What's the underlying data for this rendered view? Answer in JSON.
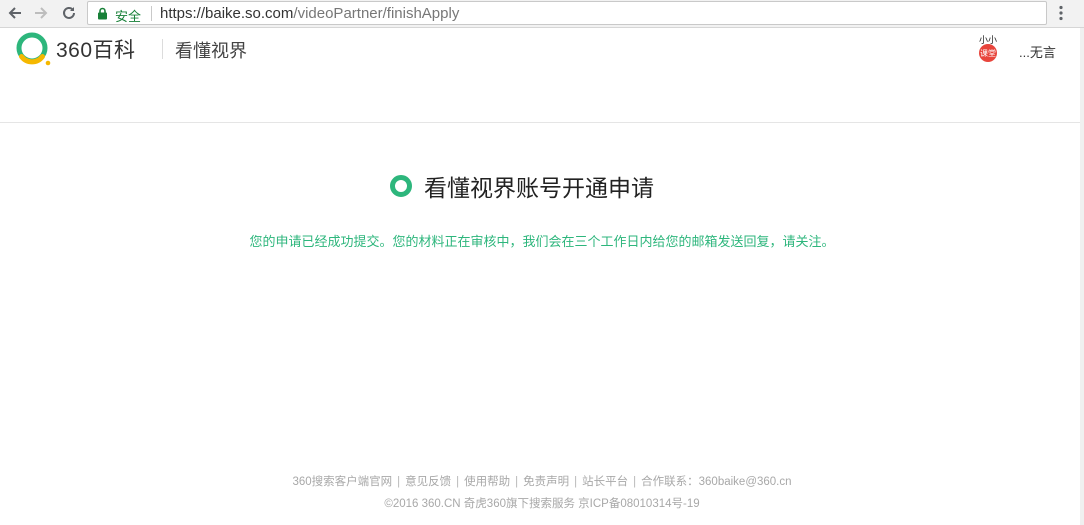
{
  "browser": {
    "secure_label": "安全",
    "url_scheme_host": "https://baike.so.com",
    "url_path": "/videoPartner/finishApply"
  },
  "header": {
    "logo_text": "360百科",
    "section_title": "看懂视界",
    "user_name": "...无言",
    "avatar_text_top": "小小",
    "avatar_text_bottom": "课堂"
  },
  "main": {
    "heading": "看懂视界账号开通申请",
    "message": "您的申请已经成功提交。您的材料正在审核中，我们会在三个工作日内给您的邮箱发送回复，请关注。"
  },
  "footer": {
    "links": [
      "360搜索客户端官网",
      "意见反馈",
      "使用帮助",
      "免责声明",
      "站长平台",
      "合作联系：360baike@360.cn"
    ],
    "copyright": "©2016 360.CN 奇虎360旗下搜索服务 京ICP备08010314号-19"
  },
  "colors": {
    "brand_green": "#2db67c",
    "logo_yellow": "#f5b800"
  }
}
